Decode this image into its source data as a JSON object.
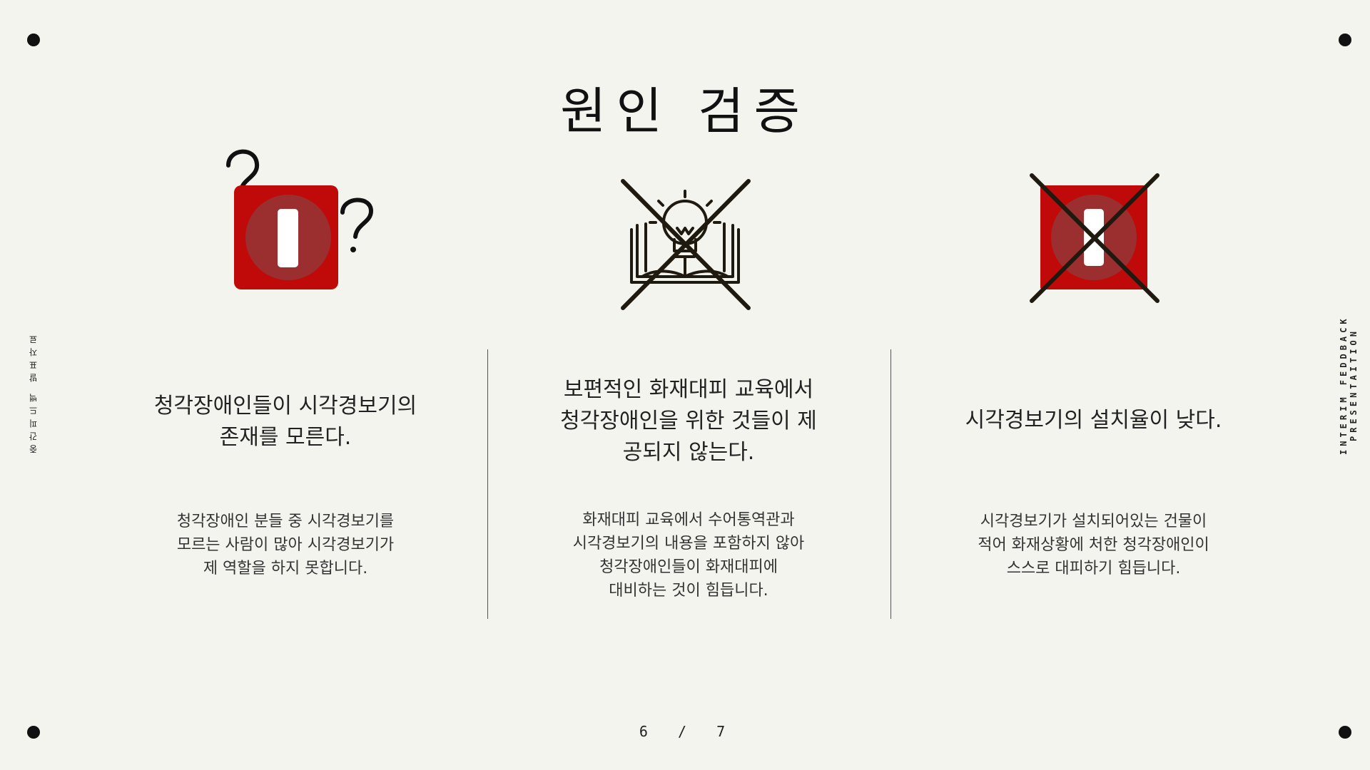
{
  "slide": {
    "title": "원인 검증",
    "side_left": "중간피드백 발표자료",
    "side_right": "INTERIM FEDDBACK PRESENTAITION",
    "page_current": "6",
    "page_separator": "/",
    "page_total": "7"
  },
  "columns": [
    {
      "icon": "warning-box-with-question-marks-icon",
      "heading_line1": "청각장애인들이 시각경보기의",
      "heading_line2": "존재를 모른다.",
      "body_line1": "청각장애인 분들 중 시각경보기를",
      "body_line2": "모르는 사람이 많아 시각경보기가",
      "body_line3": "제 역할을 하지 못합니다."
    },
    {
      "icon": "crossed-out-lightbulb-book-icon",
      "heading_line1": "보편적인 화재대피 교육에서",
      "heading_line2": "청각장애인을 위한 것들이 제",
      "heading_line3": "공되지 않는다.",
      "body_line1": "화재대피 교육에서 수어통역관과",
      "body_line2": "시각경보기의 내용을 포함하지 않아",
      "body_line3": "청각장애인들이 화재대피에",
      "body_line4": "대비하는 것이 힘듭니다."
    },
    {
      "icon": "crossed-out-warning-box-icon",
      "heading_line1": "시각경보기의 설치율이 낮다.",
      "body_line1": "시각경보기가 설치되어있는 건물이",
      "body_line2": "적어 화재상황에 처한 청각장애인이",
      "body_line3": "스스로 대피하기 힘듭니다."
    }
  ],
  "colors": {
    "background": "#f4f4ef",
    "accent_red": "#c00a0a",
    "accent_circle": "#9b2e2e",
    "cross_line": "#1f1a10",
    "text": "#222222"
  }
}
